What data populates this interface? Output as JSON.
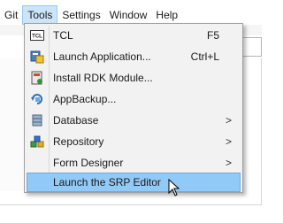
{
  "menubar": {
    "items": [
      {
        "label": "Git"
      },
      {
        "label": "Tools"
      },
      {
        "label": "Settings"
      },
      {
        "label": "Window"
      },
      {
        "label": "Help"
      }
    ],
    "active": "Tools"
  },
  "tools_menu": {
    "items": [
      {
        "label": "TCL",
        "shortcut": "F5",
        "icon": "tcl-icon",
        "submenu": false
      },
      {
        "label": "Launch Application...",
        "shortcut": "Ctrl+L",
        "icon": "launch-application-icon",
        "submenu": false
      },
      {
        "label": "Install RDK Module...",
        "shortcut": "",
        "icon": "install-rdk-icon",
        "submenu": false
      },
      {
        "label": "AppBackup...",
        "shortcut": "",
        "icon": "appbackup-icon",
        "submenu": false
      },
      {
        "label": "Database",
        "shortcut": "",
        "icon": "database-icon",
        "submenu": true
      },
      {
        "label": "Repository",
        "shortcut": "",
        "icon": "repository-icon",
        "submenu": true
      },
      {
        "label": "Form Designer",
        "shortcut": "",
        "icon": "",
        "submenu": true
      },
      {
        "label": "Launch the SRP Editor",
        "shortcut": "",
        "icon": "",
        "submenu": false,
        "highlighted": true
      }
    ],
    "submenu_glyph": ">",
    "icon_text": {
      "tcl": "TCL"
    }
  },
  "colors": {
    "menu_background": "#f2f2f2",
    "highlight": "#91c9f7",
    "highlight_border": "#70aae0",
    "menubar_active": "#cce4f7"
  }
}
